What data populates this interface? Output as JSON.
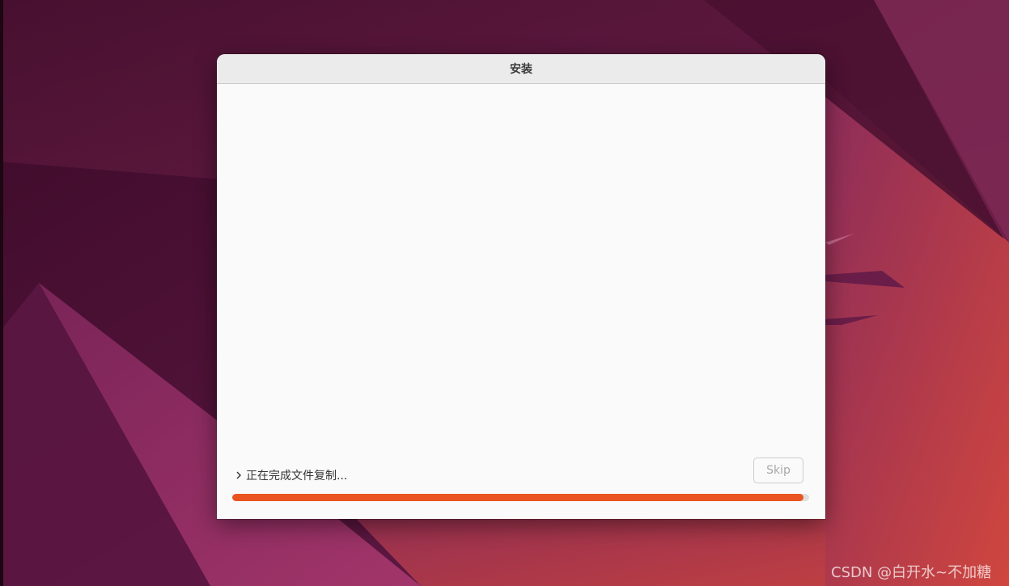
{
  "window": {
    "title": "安装"
  },
  "status": {
    "expander_icon": "chevron-right-icon",
    "text": "正在完成文件复制..."
  },
  "skip_button": {
    "label": "Skip",
    "enabled": false
  },
  "progress": {
    "fraction": 0.99,
    "color": "#e95420"
  },
  "watermark": {
    "text": "CSDN @白开水~不加糖"
  },
  "colors": {
    "accent": "#e95420"
  }
}
